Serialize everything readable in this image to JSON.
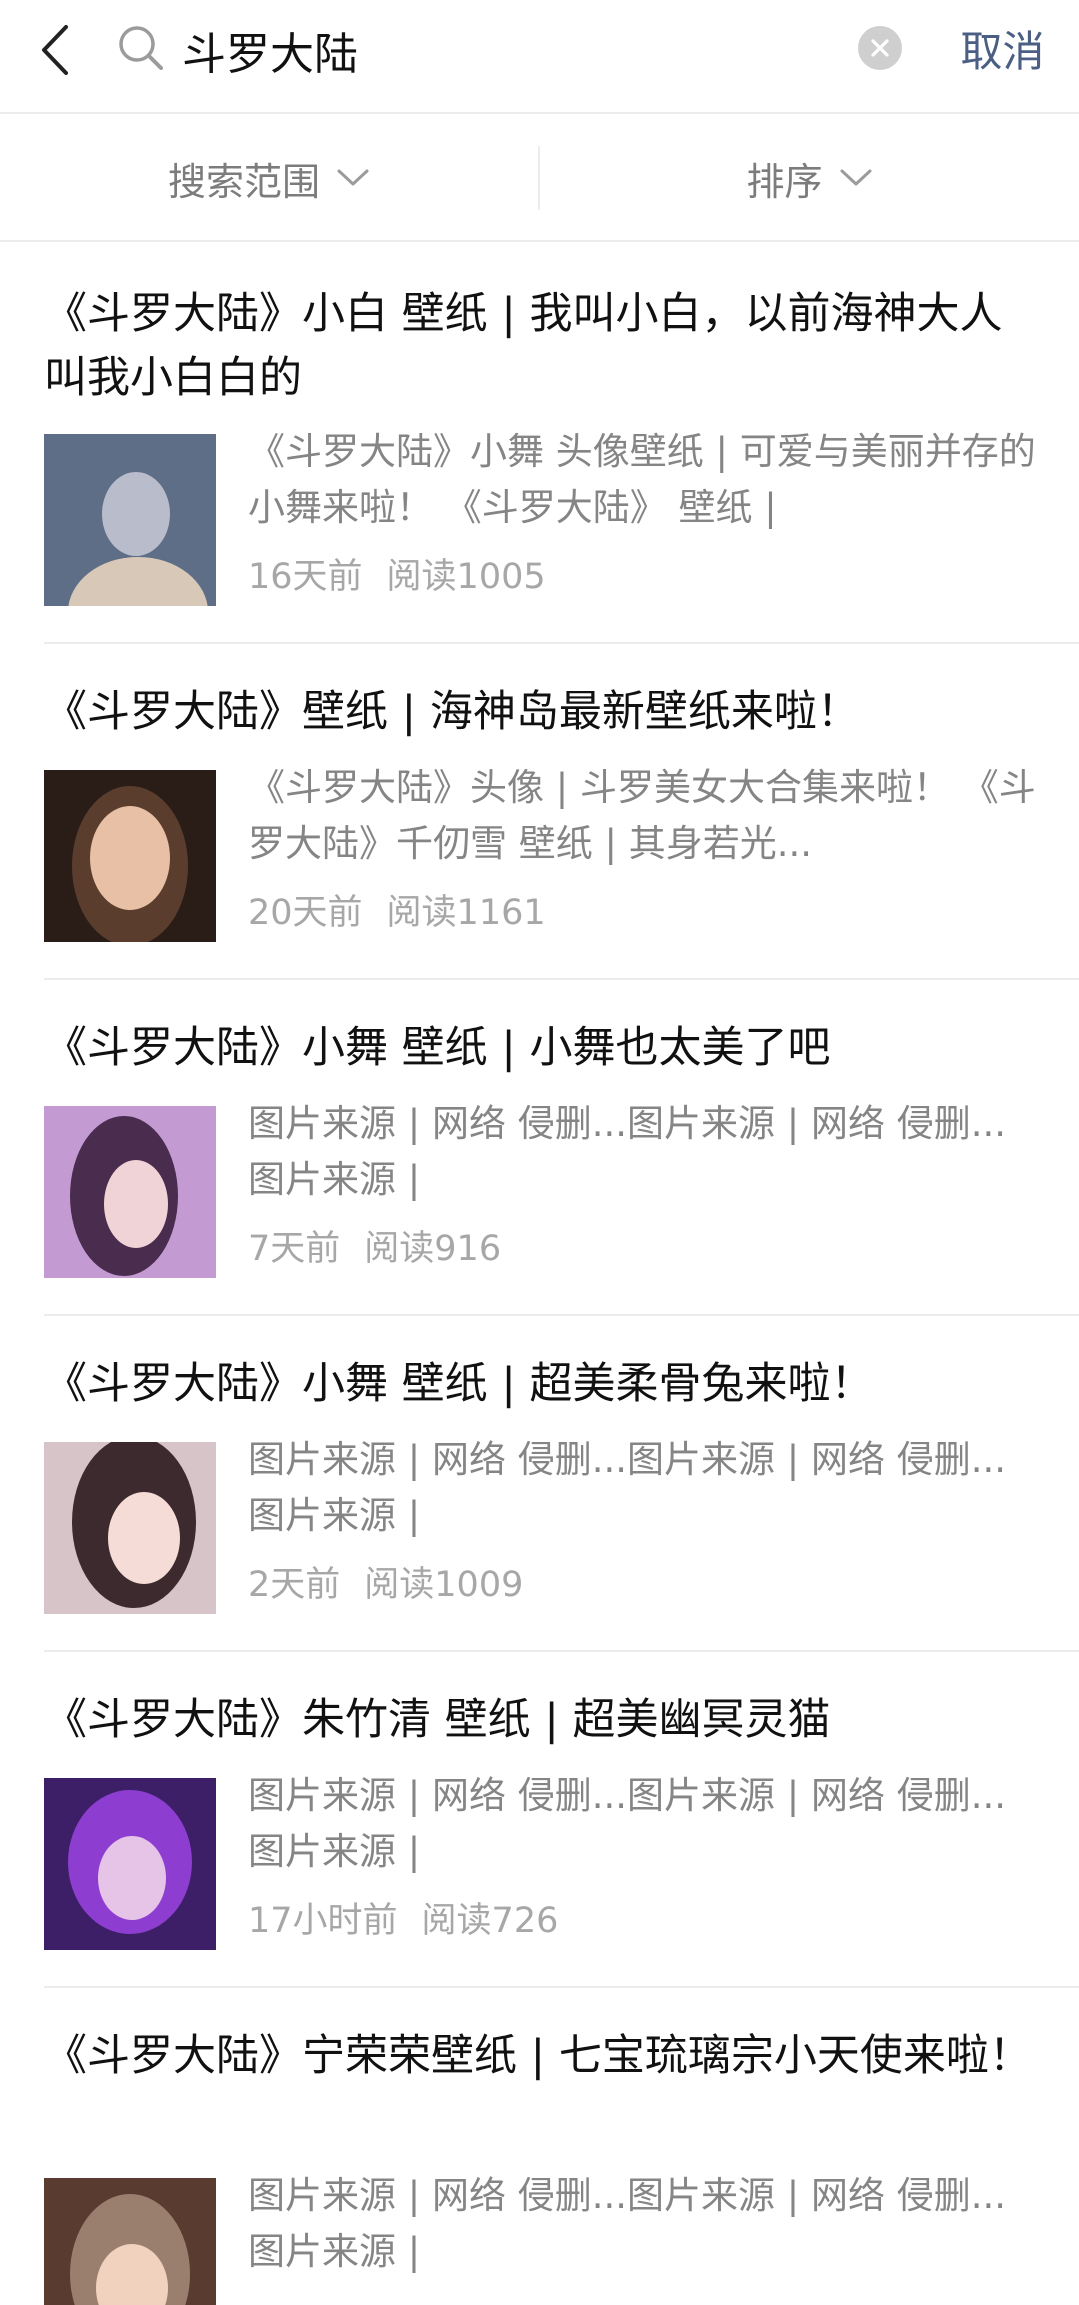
{
  "search": {
    "query": "斗罗大陆",
    "cancel_label": "取消"
  },
  "filters": {
    "scope_label": "搜索范围",
    "sort_label": "排序"
  },
  "results": [
    {
      "title": "《斗罗大陆》小白 壁纸 | 我叫小白，以前海神大人叫我小白白的",
      "snippet": "《斗罗大陆》小舞 头像壁纸 | 可爱与美丽并存的小舞来啦！ 《斗罗大陆》 壁纸 |",
      "time": "16天前",
      "reads": "阅读1005",
      "thumb_colors": [
        "#5e6e86",
        "#b9bccb",
        "#d8c8b8"
      ]
    },
    {
      "title": "《斗罗大陆》壁纸 | 海神岛最新壁纸来啦！",
      "snippet": "《斗罗大陆》头像 | 斗罗美女大合集来啦！ 《斗罗大陆》千仞雪 壁纸 | 其身若光...",
      "time": "20天前",
      "reads": "阅读1161",
      "thumb_colors": [
        "#2a1d18",
        "#5b3d2d",
        "#e8c0a6"
      ]
    },
    {
      "title": "《斗罗大陆》小舞 壁纸 | 小舞也太美了吧",
      "snippet": "图片来源 | 网络 侵删...图片来源 | 网络 侵删...图片来源 |",
      "time": "7天前",
      "reads": "阅读916",
      "thumb_colors": [
        "#c39bd2",
        "#4a2d4e",
        "#f0d3d6"
      ]
    },
    {
      "title": "《斗罗大陆》小舞 壁纸 | 超美柔骨兔来啦！",
      "snippet": "图片来源 | 网络 侵删...图片来源 | 网络 侵删...图片来源 |",
      "time": "2天前",
      "reads": "阅读1009",
      "thumb_colors": [
        "#d7c4c9",
        "#3c2a2e",
        "#f5dcd6"
      ]
    },
    {
      "title": "《斗罗大陆》朱竹清 壁纸 | 超美幽冥灵猫",
      "snippet": "图片来源 | 网络 侵删...图片来源 | 网络 侵删...图片来源 |",
      "time": "17小时前",
      "reads": "阅读726",
      "thumb_colors": [
        "#3d1f67",
        "#8d3ed1",
        "#e5c4e8"
      ]
    },
    {
      "title": "《斗罗大陆》宁荣荣壁纸 | 七宝琉璃宗小天使来啦！",
      "snippet": "图片来源 | 网络 侵删...图片来源 | 网络 侵删...图片来源 |",
      "time": "",
      "reads": "",
      "thumb_colors": [
        "#5a3b2f",
        "#9a7f6f",
        "#f0d2bf"
      ]
    }
  ]
}
